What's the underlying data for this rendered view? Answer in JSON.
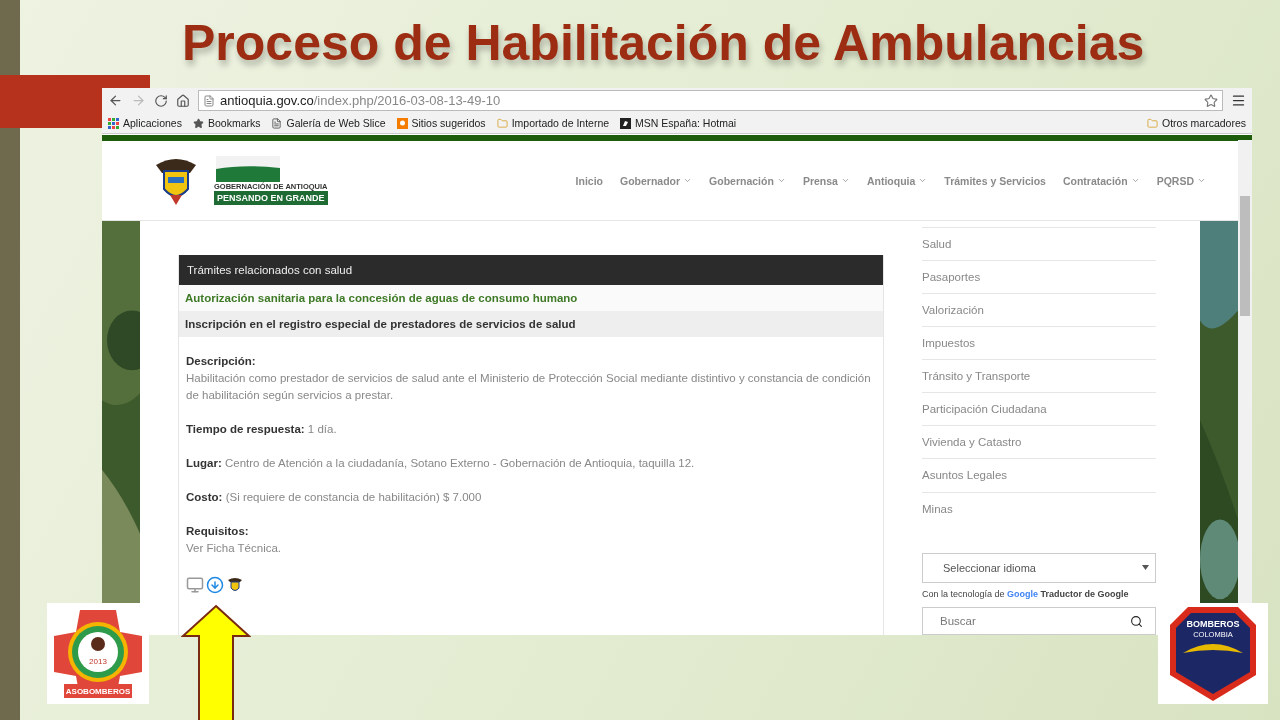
{
  "slide": {
    "title": "Proceso de Habilitación de Ambulancias"
  },
  "browser": {
    "url_host": "antioquia.gov.co",
    "url_path": "/index.php/2016-03-08-13-49-10",
    "bookmarks": [
      {
        "label": "Aplicaciones",
        "kind": "apps"
      },
      {
        "label": "Bookmarks",
        "kind": "star"
      },
      {
        "label": "Galería de Web Slice",
        "kind": "page"
      },
      {
        "label": "Sitios sugeridos",
        "kind": "suggested"
      },
      {
        "label": "Importado de Interne",
        "kind": "folder"
      },
      {
        "label": "MSN España: Hotmai",
        "kind": "msn"
      }
    ],
    "other_bookmarks": "Otros marcadores"
  },
  "site": {
    "logo_caption": "GOBERNACIÓN DE ANTIOQUIA",
    "logo_slogan": "PENSANDO EN GRANDE",
    "nav": [
      {
        "label": "Inicio",
        "dropdown": false
      },
      {
        "label": "Gobernador",
        "dropdown": true
      },
      {
        "label": "Gobernación",
        "dropdown": true
      },
      {
        "label": "Prensa",
        "dropdown": true
      },
      {
        "label": "Antioquia",
        "dropdown": true
      },
      {
        "label": "Trámites y Servicios",
        "dropdown": false
      },
      {
        "label": "Contratación",
        "dropdown": true
      },
      {
        "label": "PQRSD",
        "dropdown": true
      }
    ]
  },
  "panel": {
    "header": "Trámites relacionados con salud",
    "items": [
      {
        "label": "Autorización sanitaria para la concesión de aguas de consumo humano",
        "selected": false
      },
      {
        "label": "Inscripción en el registro especial de prestadores de servicios de salud",
        "selected": true
      }
    ],
    "details": [
      {
        "kind": "block",
        "label": "Descripción:",
        "value": "Habilitación como prestador de servicios de salud ante el Ministerio de Protección Social mediante distintivo y constancia de condición de habilitación según servicios a prestar."
      },
      {
        "kind": "inline",
        "label": "Tiempo de respuesta:",
        "value": "1 día."
      },
      {
        "kind": "inline",
        "label": "Lugar:",
        "value": "Centro de Atención a la ciudadanía, Sotano Externo - Gobernación de Antioquia, taquilla 12."
      },
      {
        "kind": "inline",
        "label": "Costo:",
        "value": "(Si requiere de constancia de habilitación)  $ 7.000"
      },
      {
        "kind": "block",
        "label": "Requisitos:",
        "value": "Ver Ficha Técnica."
      }
    ]
  },
  "sidebar": {
    "links": [
      "Salud",
      "Pasaportes",
      "Valorización",
      "Impuestos",
      "Tránsito y Transporte",
      "Participación Ciudadana",
      "Vivienda y Catastro",
      "Asuntos Legales",
      "Minas"
    ],
    "language_select": "Seleccionar idioma",
    "translate_prefix": "Con la tecnología de",
    "translate_brand": "Google",
    "translate_suffix": "Traductor de Google",
    "search_placeholder": "Buscar"
  },
  "logos": {
    "left_year": "2013",
    "left_name": "ASOBOMBEROS",
    "right_name": "BOMBEROS",
    "right_country": "COLOMBIA"
  }
}
